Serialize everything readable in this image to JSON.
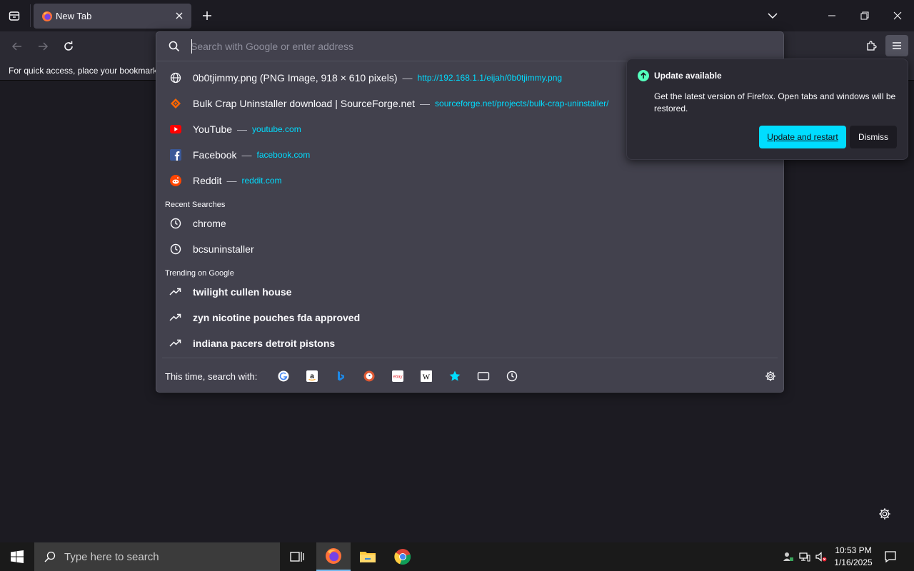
{
  "colors": {
    "accent": "#00ddff",
    "toolbar": "#2b2a33",
    "page_bg": "#1c1b22",
    "popup": "#42414d",
    "update_green": "#54ffbd"
  },
  "tabs": [
    {
      "title": "New Tab",
      "icon": "firefox-icon"
    }
  ],
  "bookmarks_bar": {
    "text": "For quick access, place your bookmarks"
  },
  "urlbar": {
    "placeholder": "Search with Google or enter address",
    "results": [
      {
        "icon": "globe-icon",
        "title": "0b0tjimmy.png (PNG Image, 918 × 610 pixels)",
        "sep": "—",
        "url": "http://192.168.1.1/eijah/0b0tjimmy.png"
      },
      {
        "icon": "sourceforge-icon",
        "title": "Bulk Crap Uninstaller download | SourceForge.net",
        "sep": "—",
        "url": "sourceforge.net/projects/bulk-crap-uninstaller/"
      },
      {
        "icon": "youtube-icon",
        "title": "YouTube",
        "sep": "—",
        "url": "youtube.com"
      },
      {
        "icon": "facebook-icon",
        "title": "Facebook",
        "sep": "—",
        "url": "facebook.com"
      },
      {
        "icon": "reddit-icon",
        "title": "Reddit",
        "sep": "—",
        "url": "reddit.com"
      }
    ],
    "recent_label": "Recent Searches",
    "recent": [
      "chrome",
      "bcsuninstaller"
    ],
    "trending_label": "Trending on Google",
    "trending": [
      "twilight cullen house",
      "zyn nicotine pouches fda approved",
      "indiana pacers detroit pistons"
    ],
    "oneoff_label": "This time, search with:",
    "engines": [
      "google-icon",
      "amazon-icon",
      "bing-icon",
      "duckduckgo-icon",
      "ebay-icon",
      "wikipedia-icon",
      "bookmarks-star-icon",
      "tabs-icon",
      "history-icon"
    ]
  },
  "update_panel": {
    "title": "Update available",
    "description": "Get the latest version of Firefox. Open tabs and windows will be restored.",
    "primary": "Update and restart",
    "secondary": "Dismiss"
  },
  "taskbar": {
    "search_placeholder": "Type here to search",
    "time": "10:53 PM",
    "date": "1/16/2025"
  }
}
